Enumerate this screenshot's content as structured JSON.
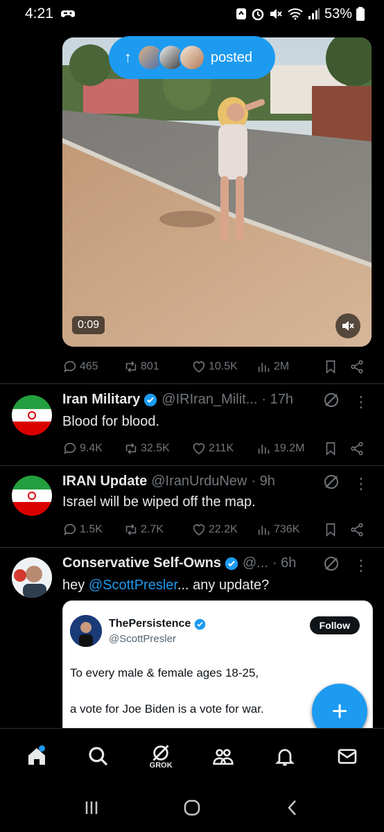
{
  "status_bar": {
    "time": "4:21",
    "battery": "53%"
  },
  "posted_pill": {
    "label": "posted"
  },
  "video_post": {
    "duration": "0:09",
    "replies": "465",
    "reposts": "801",
    "likes": "10.5K",
    "views": "2M"
  },
  "posts": [
    {
      "name": "Iran Military",
      "handle": "@IRIran_Milit...",
      "time": "· 17h",
      "text": "Blood for blood.",
      "replies": "9.4K",
      "reposts": "32.5K",
      "likes": "211K",
      "views": "19.2M"
    },
    {
      "name": "IRAN Update",
      "handle": "@IranUrduNew",
      "time": "· 9h",
      "text": "Israel will be wiped off the map.",
      "replies": "1.5K",
      "reposts": "2.7K",
      "likes": "22.2K",
      "views": "736K"
    },
    {
      "name": "Conservative Self-Owns",
      "handle": "@...",
      "time": "· 6h",
      "text_prefix": "hey ",
      "text_mention": "@ScottPresler",
      "text_suffix": "... any update?"
    }
  ],
  "quote": {
    "name": "ThePersistence",
    "handle": "@ScottPresler",
    "follow_label": "Follow",
    "line1": "To every male & female ages 18-25,",
    "line2": "a vote for Joe Biden is a vote for war."
  },
  "nav": {
    "grok_label": "GROK"
  },
  "icons": {
    "home": "home-icon",
    "search": "search-icon",
    "grok": "grok-icon",
    "communities": "communities-icon",
    "notifications": "bell-icon",
    "messages": "mail-icon"
  },
  "colors": {
    "accent": "#1d9bf0",
    "background": "#000000",
    "muted": "#71767b"
  }
}
